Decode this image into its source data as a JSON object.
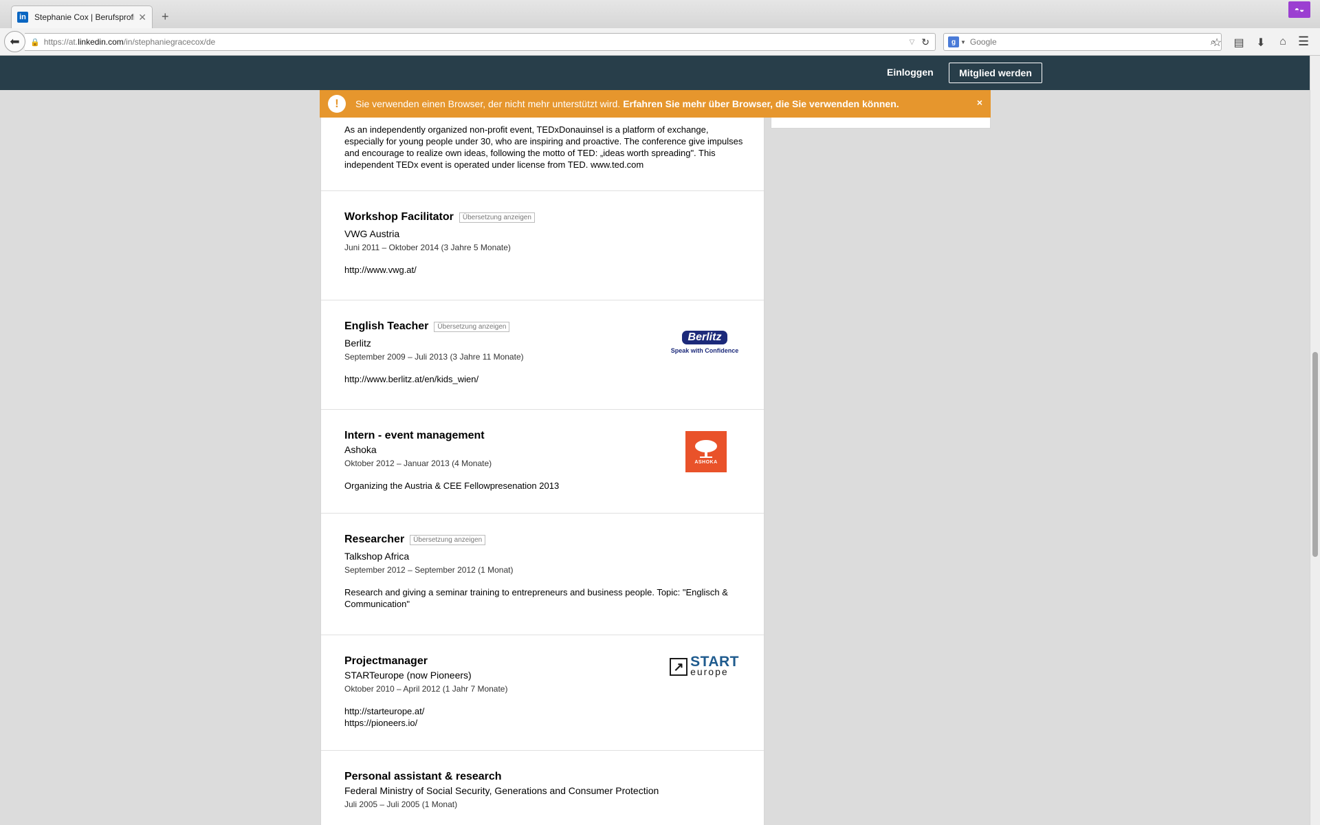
{
  "browser": {
    "tab_title": "Stephanie Cox | Berufsprofil",
    "tab_favicon": "in",
    "url_prefix": "https://at.",
    "url_domain": "linkedin.com",
    "url_path": "/in/stephaniegracecox/de",
    "search_placeholder": "Google"
  },
  "header": {
    "login": "Einloggen",
    "join": "Mitglied werden"
  },
  "warning": {
    "text": "Sie verwenden einen Browser, der nicht mehr unterstützt wird.",
    "link": "Erfahren Sie mehr über Browser, die Sie verwenden können.",
    "close": "×"
  },
  "first_entry_desc": "As an independently organized non-profit event, TEDxDonauinsel is a platform of exchange, especially for young people under 30, who are inspiring and proactive. The conference give impulses and encourage to realize own ideas, following the motto of TED: „ideas worth spreading\". This independent TEDx event is operated under license from TED. www.ted.com",
  "translate_label": "Übersetzung anzeigen",
  "entries": [
    {
      "title": "Workshop Facilitator",
      "company": "VWG Austria",
      "dates": "Juni 2011 – Oktober 2014 (3 Jahre 5 Monate)",
      "links": [
        "http://www.vwg.at/"
      ]
    },
    {
      "title": "English Teacher",
      "company": "Berlitz",
      "dates": "September 2009 – Juli 2013 (3 Jahre 11 Monate)",
      "links": [
        "http://www.berlitz.at/en/kids_wien/"
      ],
      "logo_name": "Berlitz",
      "logo_tagline": "Speak with Confidence"
    },
    {
      "title": "Intern - event management",
      "company": "Ashoka",
      "dates": "Oktober 2012 – Januar 2013 (4 Monate)",
      "desc": "Organizing the Austria & CEE Fellowpresenation 2013",
      "logo_name": "ASHOKA"
    },
    {
      "title": "Researcher",
      "company": "Talkshop Africa",
      "dates": "September 2012 – September 2012 (1 Monat)",
      "desc": "Research and giving a seminar training to entrepreneurs and business people. Topic: \"Englisch & Communication\""
    },
    {
      "title": "Projectmanager",
      "company": "STARTeurope (now Pioneers)",
      "dates": "Oktober 2010 – April 2012 (1 Jahr 7 Monate)",
      "links": [
        "http://starteurope.at/",
        "https://pioneers.io/"
      ],
      "logo_big": "START",
      "logo_small": "europe"
    },
    {
      "title": "Personal assistant & research",
      "company": "Federal Ministry of Social Security, Generations and Consumer Protection",
      "dates": "Juli 2005 – Juli 2005 (1 Monat)"
    }
  ],
  "colors": {
    "linkedin_header": "#283e4a",
    "warning": "#e6962d",
    "page_bg": "#dcdcdc"
  }
}
